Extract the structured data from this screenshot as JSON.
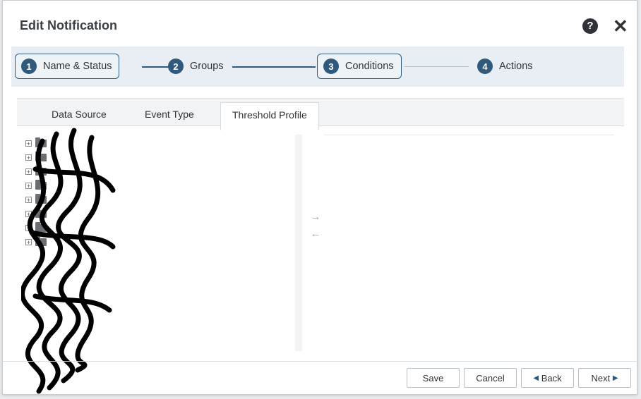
{
  "dialog": {
    "title": "Edit Notification"
  },
  "header_icons": {
    "help": "?",
    "close": "✕"
  },
  "steps": [
    {
      "num": "1",
      "label": "Name & Status",
      "active": true
    },
    {
      "num": "2",
      "label": "Groups",
      "active": false
    },
    {
      "num": "3",
      "label": "Conditions",
      "active": true
    },
    {
      "num": "4",
      "label": "Actions",
      "active": false
    }
  ],
  "tabs": [
    {
      "label": "Data Source",
      "selected": false
    },
    {
      "label": "Event Type",
      "selected": false
    },
    {
      "label": "Threshold Profile",
      "selected": true
    }
  ],
  "tree": {
    "expand_glyph": "+"
  },
  "transfer": {
    "right": "→",
    "left": "←"
  },
  "buttons": {
    "save": "Save",
    "cancel": "Cancel",
    "back": "Back",
    "next": "Next"
  },
  "glyphs": {
    "back_arrow": "◀",
    "next_arrow": "▶"
  },
  "colors": {
    "accent": "#2f5a7d"
  }
}
